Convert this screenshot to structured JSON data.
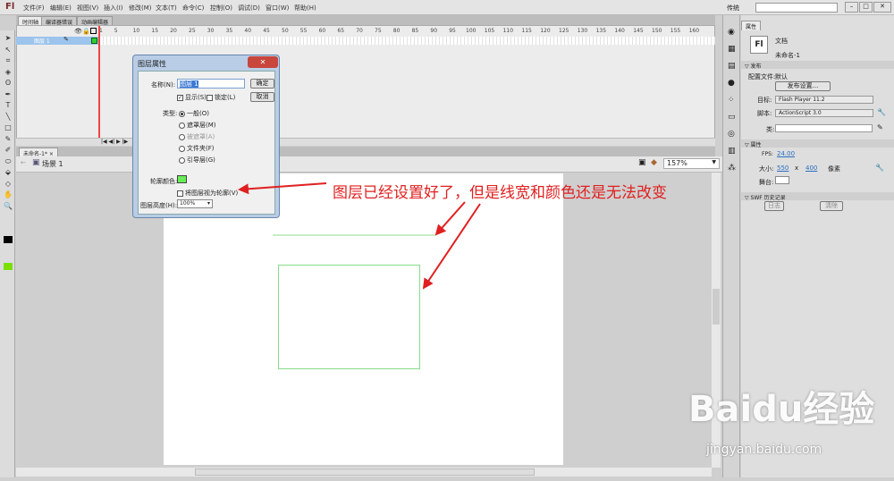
{
  "app": {
    "logo": "Fl",
    "workspace": "传统",
    "search_placeholder": ""
  },
  "menu": [
    "文件(F)",
    "编辑(E)",
    "视图(V)",
    "插入(I)",
    "修改(M)",
    "文本(T)",
    "命令(C)",
    "控制(O)",
    "调试(D)",
    "窗口(W)",
    "帮助(H)"
  ],
  "timeline": {
    "tabs": [
      "时间轴",
      "编译器错误",
      "动画编辑器"
    ],
    "layer_name": "图层 1",
    "frame_numbers": [
      "1",
      "5",
      "10",
      "15",
      "20",
      "25",
      "30",
      "35",
      "40",
      "45",
      "50",
      "55",
      "60",
      "65",
      "70",
      "75",
      "80",
      "85",
      "90",
      "95",
      "100",
      "105",
      "110",
      "115",
      "120",
      "125",
      "130",
      "135",
      "140",
      "145",
      "150",
      "155",
      "160"
    ]
  },
  "document": {
    "tab": "未命名-1*",
    "scene": "场景 1",
    "zoom": "157%"
  },
  "dialog": {
    "title": "图层属性",
    "name_label": "名称(N):",
    "name_value": "图层 1",
    "ok": "确定",
    "cancel": "取消",
    "show": "显示(S)",
    "lock": "锁定(L)",
    "type_label": "类型:",
    "types": [
      "一般(O)",
      "遮罩层(M)",
      "被遮罩(A)",
      "文件夹(F)",
      "引导层(G)"
    ],
    "outline_color_label": "轮廓颜色:",
    "outline_color": "#66ee55",
    "view_as_outline": "将图层视为轮廓(V)",
    "height_label": "图层高度(H):",
    "height_value": "100%"
  },
  "properties": {
    "tab": "属性",
    "doc_type": "文档",
    "doc_name": "未命名-1",
    "publish_section": "发布",
    "profile_label": "配置文件:",
    "profile_value": "默认",
    "publish_settings": "发布设置...",
    "target_label": "目标:",
    "target_value": "Flash Player 11.2",
    "script_label": "脚本:",
    "script_value": "ActionScript 3.0",
    "class_label": "类:",
    "props_section": "属性",
    "fps_label": "FPS:",
    "fps": "24.00",
    "size_label": "大小:",
    "width": "550",
    "x": "x",
    "height": "400",
    "unit": "像素",
    "stage_label": "舞台:",
    "swf_section": "SWF 历史记录",
    "log": "日志",
    "clear": "清除"
  },
  "annotation": "图层已经设置好了，但是线宽和颜色还是无法改变",
  "watermark": {
    "brand": "Baidu经验",
    "url": "jingyan.baidu.com"
  },
  "colors": {
    "annotation": "#e02020",
    "stroke": "#88dd88",
    "layer_highlight": "#9cc4ec"
  }
}
